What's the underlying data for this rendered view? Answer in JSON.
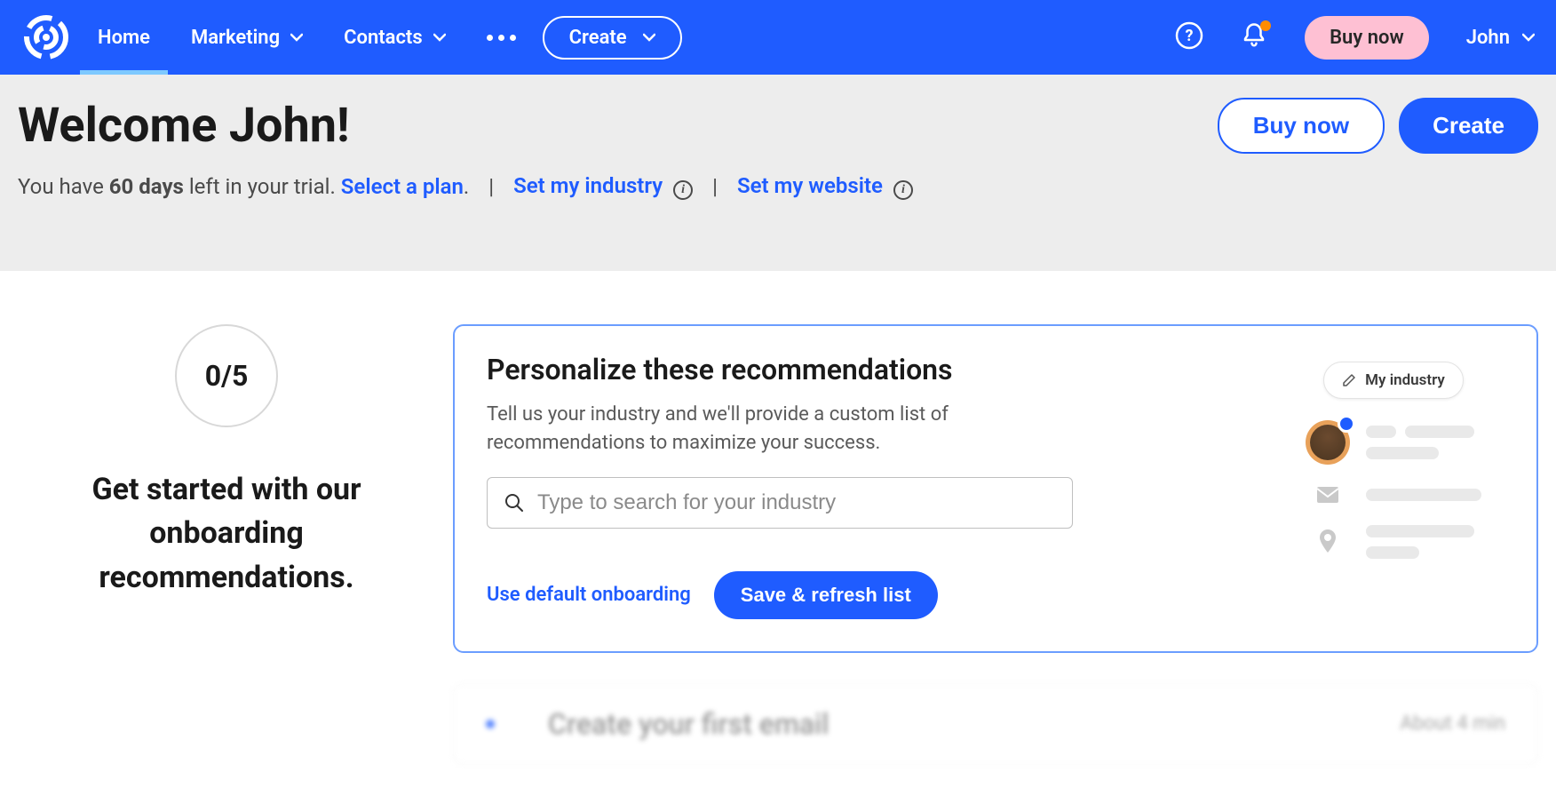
{
  "nav": {
    "home": "Home",
    "marketing": "Marketing",
    "contacts": "Contacts",
    "create": "Create",
    "buy_now": "Buy now",
    "user": "John"
  },
  "welcome": {
    "title": "Welcome John!",
    "trial_prefix": "You have ",
    "trial_days": "60 days",
    "trial_suffix": " left in your trial. ",
    "select_plan": "Select a plan",
    "set_industry": "Set my industry",
    "set_website": "Set my website",
    "buy_now": "Buy now",
    "create": "Create"
  },
  "onboarding": {
    "progress": "0/5",
    "heading": "Get started with our onboarding recommendations."
  },
  "personalize": {
    "title": "Personalize these recommendations",
    "subtitle": "Tell us your industry and we'll provide a custom list of recommendations to maximize your success.",
    "search_placeholder": "Type to search for your industry",
    "default_link": "Use default onboarding",
    "save_btn": "Save & refresh list",
    "my_industry": "My industry"
  },
  "next_item": {
    "title": "Create your first email",
    "time": "About 4 min"
  }
}
